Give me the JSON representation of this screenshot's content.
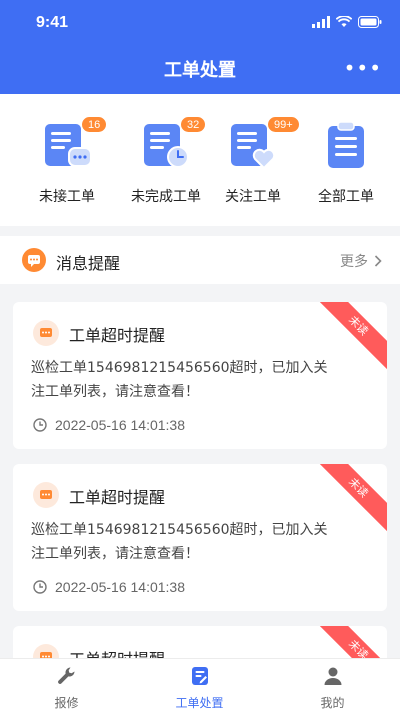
{
  "status_bar": {
    "time": "9:41"
  },
  "header": {
    "title": "工单处置",
    "more_icon": "more-dots-icon",
    "background": "#3f6ef3"
  },
  "categories": [
    {
      "label": "未接工单",
      "badge": "16",
      "icon": "document-chat-icon"
    },
    {
      "label": "未完成工单",
      "badge": "32",
      "icon": "document-clock-icon"
    },
    {
      "label": "关注工单",
      "badge": "99+",
      "icon": "document-heart-icon"
    },
    {
      "label": "全部工单",
      "badge": "",
      "icon": "clipboard-list-icon"
    }
  ],
  "messages": {
    "title": "消息提醒",
    "more_label": "更多"
  },
  "notifications": [
    {
      "title": "工单超时提醒",
      "body": "巡检工单1546981215456560超时，已加入关注工单列表，请注意查看！",
      "time": "2022-05-16  14:01:38",
      "ribbon": "未读"
    },
    {
      "title": "工单超时提醒",
      "body": "巡检工单1546981215456560超时，已加入关注工单列表，请注意查看！",
      "time": "2022-05-16  14:01:38",
      "ribbon": "未读"
    },
    {
      "title": "工单超时提醒",
      "body": "",
      "time": "",
      "ribbon": "未读"
    }
  ],
  "tabbar": [
    {
      "label": "报修",
      "icon": "wrench-icon",
      "active": false
    },
    {
      "label": "工单处置",
      "icon": "edit-document-icon",
      "active": true
    },
    {
      "label": "我的",
      "icon": "person-icon",
      "active": false
    }
  ],
  "colors": {
    "accent": "#3f6ef3",
    "badge": "#ff8a33",
    "ribbon": "#ff5b5b"
  }
}
